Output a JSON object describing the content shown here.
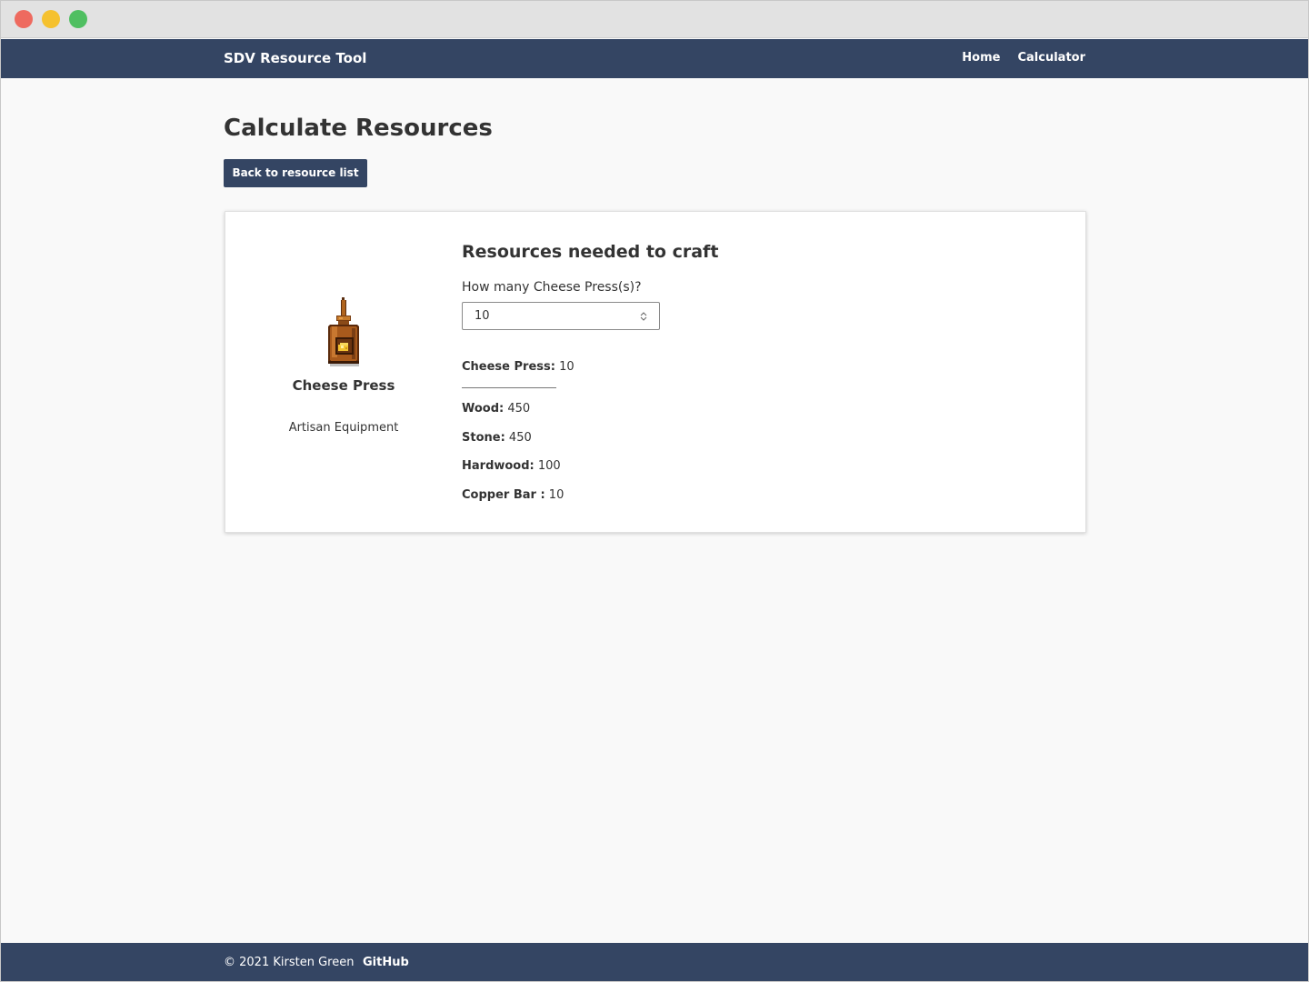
{
  "header": {
    "brand": "SDV Resource Tool",
    "nav": [
      {
        "label": "Home"
      },
      {
        "label": "Calculator"
      }
    ]
  },
  "main": {
    "title": "Calculate Resources",
    "back_button": "Back to resource list"
  },
  "item": {
    "name": "Cheese Press",
    "category": "Artisan Equipment",
    "icon": "cheese-press-icon"
  },
  "calculator": {
    "title": "Resources needed to craft",
    "quantity_label": "How many Cheese Press(s)?",
    "quantity_value": "10",
    "crafted": {
      "label": "Cheese Press:",
      "value": "10"
    },
    "resources": [
      {
        "label": "Wood:",
        "value": "450"
      },
      {
        "label": "Stone:",
        "value": "450"
      },
      {
        "label": "Hardwood:",
        "value": "100"
      },
      {
        "label": "Copper Bar :",
        "value": "10"
      }
    ]
  },
  "footer": {
    "copyright": "© 2021 Kirsten Green",
    "github": "GitHub"
  },
  "colors": {
    "navbar": "#344563",
    "background": "#f9f9f9",
    "card": "#ffffff",
    "text": "#333333"
  }
}
